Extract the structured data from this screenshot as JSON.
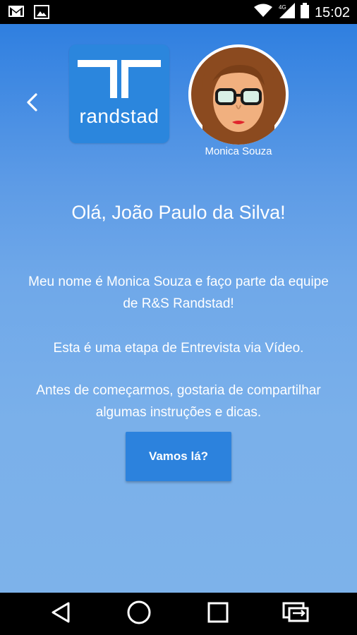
{
  "status_bar": {
    "time": "15:02",
    "left_icons": [
      "gmail-icon",
      "image-icon"
    ],
    "right_icons": [
      "wifi-icon",
      "signal-4g-icon",
      "battery-icon"
    ]
  },
  "header": {
    "logo_text": "randstad",
    "recruiter_name": "Monica Souza"
  },
  "main": {
    "greeting": "Olá, João Paulo da Silva!",
    "intro": "Meu nome é Monica Souza e faço parte da equipe de R&S Randstad!",
    "stage": "Esta é uma etapa de Entrevista via Vídeo.",
    "instructions": "Antes de começarmos, gostaria de compartilhar algumas instruções e dicas.",
    "cta_label": "Vamos lá?"
  },
  "colors": {
    "brand_blue": "#2b86dd",
    "button_blue": "#2c82dd",
    "background_top": "#2f7fe0",
    "background_bottom": "#7db2ea"
  }
}
